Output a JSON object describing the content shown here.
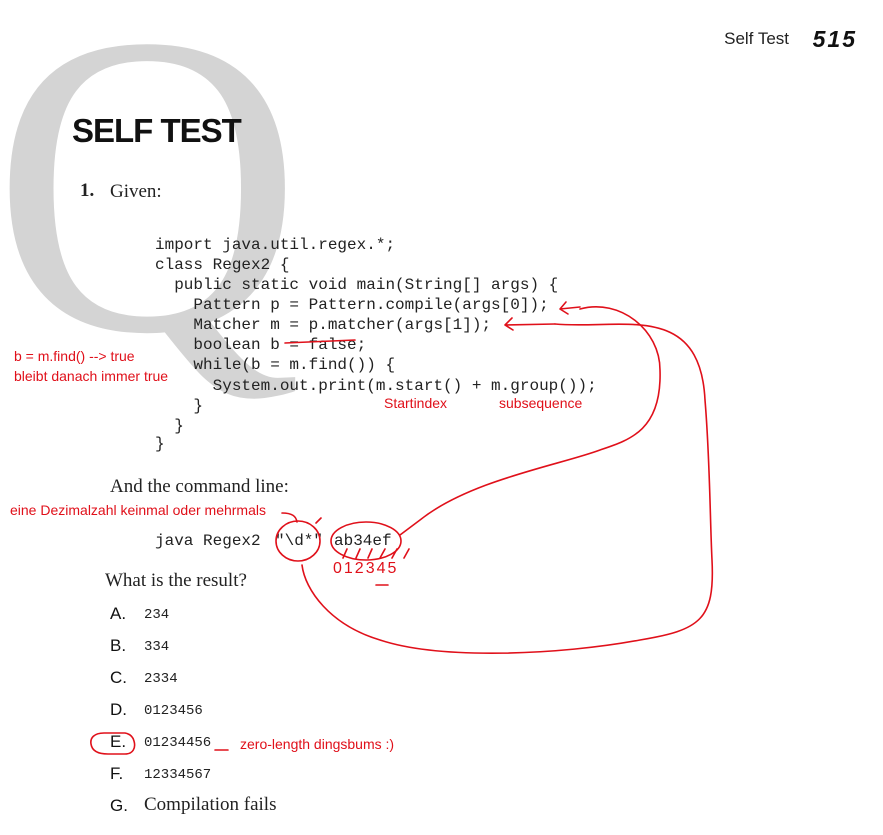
{
  "header": {
    "section_title": "Self Test",
    "page_number": "515"
  },
  "title": "SELF TEST",
  "question": {
    "number": "1.",
    "label": "Given:",
    "code_lines": [
      "import java.util.regex.*;",
      "class Regex2 {",
      "  public static void main(String[] args) {",
      "    Pattern p = Pattern.compile(args[0]);",
      "    Matcher m = p.matcher(args[1]);",
      "    boolean b = false;",
      "    while(b = m.find()) {",
      "      System.out.print(m.start() + m.group());",
      "    }",
      "  }",
      "}"
    ],
    "command_intro": "And the command line:",
    "command_prefix": "java Regex2",
    "command_regex": "\"\\d*\"",
    "command_input": "ab34ef",
    "result_prompt": "What is the result?",
    "options": [
      {
        "letter": "A.",
        "text": "234"
      },
      {
        "letter": "B.",
        "text": "334"
      },
      {
        "letter": "C.",
        "text": "2334"
      },
      {
        "letter": "D.",
        "text": "0123456"
      },
      {
        "letter": "E.",
        "text": "01234456"
      },
      {
        "letter": "F.",
        "text": "12334567"
      },
      {
        "letter": "G.",
        "text": "Compilation fails"
      }
    ]
  },
  "annotations": {
    "find_note_line1": "b = m.find() -->  true",
    "find_note_line2": "bleibt danach immer true",
    "start_note": "Startindex",
    "group_note": "subsequence",
    "regex_note": "eine Dezimalzahl keinmal oder mehrmals",
    "index_digits": "012345",
    "answer_note": "zero-length dingsbums :)",
    "ink_color": "#e0101a"
  }
}
